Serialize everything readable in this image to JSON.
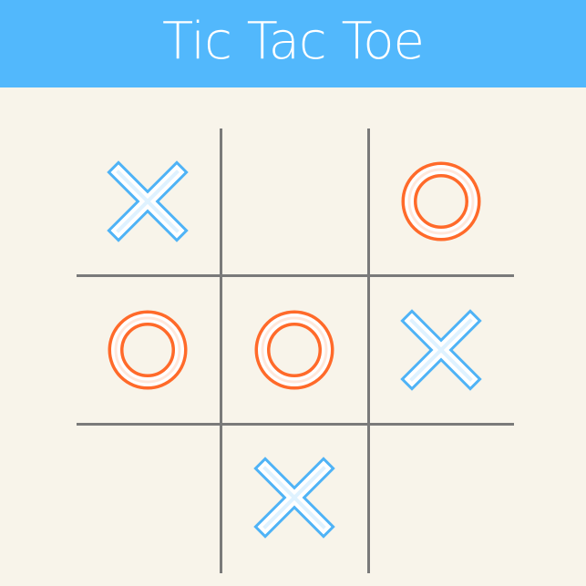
{
  "header": {
    "title": "Tic Tac Toe"
  },
  "colors": {
    "header_bg": "#52b8fc",
    "board_bg": "#f8f4ea",
    "grid_line": "#7a7a7a",
    "x_mark": "#4fb3f6",
    "o_mark": "#ff6a2a"
  },
  "board": {
    "cells": [
      "X",
      "",
      "O",
      "O",
      "O",
      "X",
      "",
      "X",
      ""
    ]
  }
}
